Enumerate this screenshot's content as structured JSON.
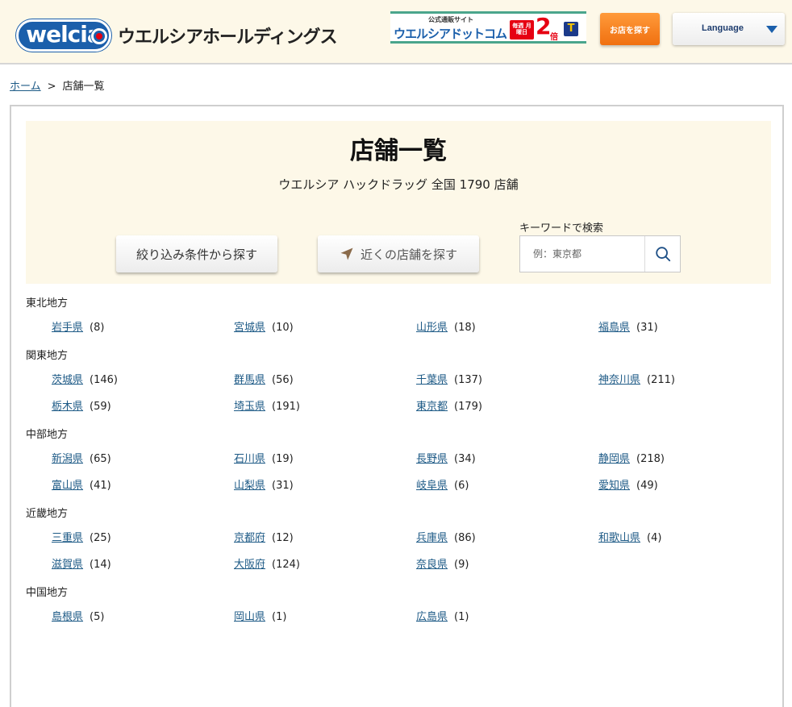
{
  "header": {
    "logo_text": "welcia",
    "company_name": "ウエルシアホールディングス",
    "banner": {
      "sub": "公式通販サイト",
      "main": "ウエルシアドットコム",
      "badge": "毎週 月曜日",
      "num": "2",
      "bai": "倍",
      "t_mark": "T"
    },
    "find_store_label": "お店を探す",
    "language_label": "Language"
  },
  "breadcrumb": {
    "home": "ホーム",
    "separator": ">",
    "current": "店舗一覧"
  },
  "hero": {
    "title": "店舗一覧",
    "subtitle": "ウエルシア ハックドラッグ 全国 1790 店舗",
    "filter_button": "絞り込み条件から探す",
    "nearby_button": "近くの店舗を探す",
    "keyword_label": "キーワードで検索",
    "keyword_placeholder": "例：東京都"
  },
  "regions": [
    {
      "name": "東北地方",
      "prefectures": [
        {
          "name": "岩手県",
          "count": "(8)"
        },
        {
          "name": "宮城県",
          "count": "(10)"
        },
        {
          "name": "山形県",
          "count": "(18)"
        },
        {
          "name": "福島県",
          "count": "(31)"
        }
      ]
    },
    {
      "name": "関東地方",
      "prefectures": [
        {
          "name": "茨城県",
          "count": "(146)"
        },
        {
          "name": "群馬県",
          "count": "(56)"
        },
        {
          "name": "千葉県",
          "count": "(137)"
        },
        {
          "name": "神奈川県",
          "count": "(211)"
        },
        {
          "name": "栃木県",
          "count": "(59)"
        },
        {
          "name": "埼玉県",
          "count": "(191)"
        },
        {
          "name": "東京都",
          "count": "(179)"
        }
      ]
    },
    {
      "name": "中部地方",
      "prefectures": [
        {
          "name": "新潟県",
          "count": "(65)"
        },
        {
          "name": "石川県",
          "count": "(19)"
        },
        {
          "name": "長野県",
          "count": "(34)"
        },
        {
          "name": "静岡県",
          "count": "(218)"
        },
        {
          "name": "富山県",
          "count": "(41)"
        },
        {
          "name": "山梨県",
          "count": "(31)"
        },
        {
          "name": "岐阜県",
          "count": "(6)"
        },
        {
          "name": "愛知県",
          "count": "(49)"
        }
      ]
    },
    {
      "name": "近畿地方",
      "prefectures": [
        {
          "name": "三重県",
          "count": "(25)"
        },
        {
          "name": "京都府",
          "count": "(12)"
        },
        {
          "name": "兵庫県",
          "count": "(86)"
        },
        {
          "name": "和歌山県",
          "count": "(4)"
        },
        {
          "name": "滋賀県",
          "count": "(14)"
        },
        {
          "name": "大阪府",
          "count": "(124)"
        },
        {
          "name": "奈良県",
          "count": "(9)"
        }
      ]
    },
    {
      "name": "中国地方",
      "prefectures": [
        {
          "name": "島根県",
          "count": "(5)"
        },
        {
          "name": "岡山県",
          "count": "(1)"
        },
        {
          "name": "広島県",
          "count": "(1)"
        }
      ]
    }
  ],
  "colors": {
    "brand_blue": "#1b5fab",
    "header_bg": "#fdf8e8",
    "find_button": "#f07010",
    "link": "#1d5a86"
  },
  "icons": {
    "search": "search-icon",
    "nearby": "location-arrow-icon",
    "language": "chevron-down-icon"
  }
}
